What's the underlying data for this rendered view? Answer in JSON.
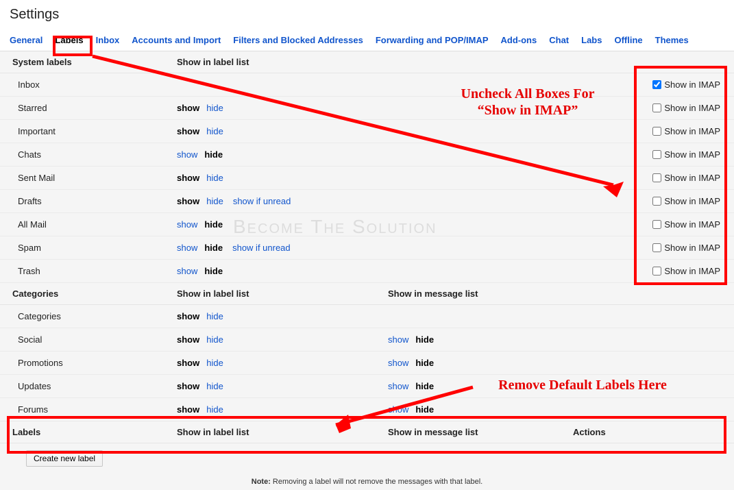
{
  "page_title": "Settings",
  "tabs": [
    "General",
    "Labels",
    "Inbox",
    "Accounts and Import",
    "Filters and Blocked Addresses",
    "Forwarding and POP/IMAP",
    "Add-ons",
    "Chat",
    "Labs",
    "Offline",
    "Themes"
  ],
  "active_tab": "Labels",
  "sections": {
    "system_header": {
      "title": "System labels",
      "col2": "Show in label list"
    },
    "categories_header": {
      "title": "Categories",
      "col2": "Show in label list",
      "col3": "Show in message list"
    },
    "labels_header": {
      "title": "Labels",
      "col2": "Show in label list",
      "col3": "Show in message list",
      "col4": "Actions"
    }
  },
  "system_rows": [
    {
      "name": "Inbox",
      "show_state": "",
      "hide_state": "",
      "extra": "",
      "imap_checked": true
    },
    {
      "name": "Starred",
      "show_state": "bold",
      "hide_state": "link",
      "extra": "",
      "imap_checked": false
    },
    {
      "name": "Important",
      "show_state": "bold",
      "hide_state": "link",
      "extra": "",
      "imap_checked": false
    },
    {
      "name": "Chats",
      "show_state": "link",
      "hide_state": "bold",
      "extra": "",
      "imap_checked": false
    },
    {
      "name": "Sent Mail",
      "show_state": "bold",
      "hide_state": "link",
      "extra": "",
      "imap_checked": false
    },
    {
      "name": "Drafts",
      "show_state": "bold",
      "hide_state": "link",
      "extra": "show if unread",
      "imap_checked": false
    },
    {
      "name": "All Mail",
      "show_state": "link",
      "hide_state": "bold",
      "extra": "",
      "imap_checked": false
    },
    {
      "name": "Spam",
      "show_state": "link",
      "hide_state": "bold",
      "extra": "show if unread",
      "imap_checked": false
    },
    {
      "name": "Trash",
      "show_state": "link",
      "hide_state": "bold",
      "extra": "",
      "imap_checked": false
    }
  ],
  "category_rows": [
    {
      "name": "Categories",
      "l_show": "bold",
      "l_hide": "link",
      "m_show": "",
      "m_hide": ""
    },
    {
      "name": "Social",
      "l_show": "bold",
      "l_hide": "link",
      "m_show": "link",
      "m_hide": "bold"
    },
    {
      "name": "Promotions",
      "l_show": "bold",
      "l_hide": "link",
      "m_show": "link",
      "m_hide": "bold"
    },
    {
      "name": "Updates",
      "l_show": "bold",
      "l_hide": "link",
      "m_show": "link",
      "m_hide": "bold"
    },
    {
      "name": "Forums",
      "l_show": "bold",
      "l_hide": "link",
      "m_show": "link",
      "m_hide": "bold"
    }
  ],
  "tokens": {
    "show": "show",
    "hide": "hide",
    "show_in_imap": "Show in IMAP"
  },
  "create_label_button": "Create new label",
  "footer_note": {
    "bold": "Note:",
    "text": " Removing a label will not remove the messages with that label."
  },
  "annotations": {
    "uncheck_text": "Uncheck All Boxes For\n“Show in IMAP”",
    "remove_text": "Remove Default Labels Here"
  },
  "watermark": "Become The Solution"
}
